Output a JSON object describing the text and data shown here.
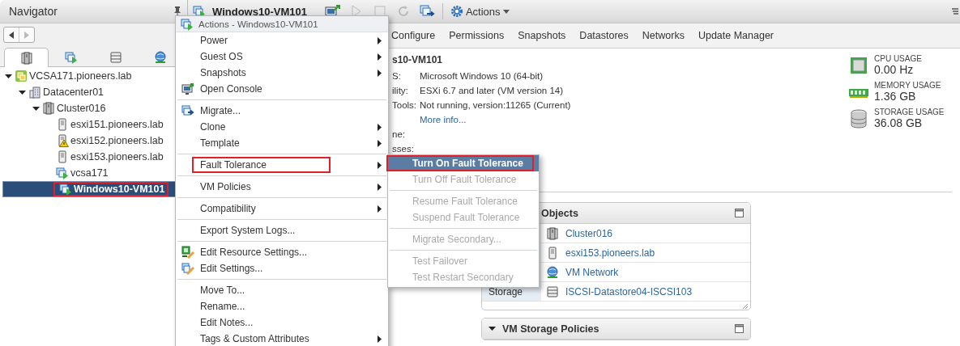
{
  "navigator": {
    "title": "Navigator",
    "tabs": [
      {
        "kind": "hosts",
        "selected": true
      },
      {
        "kind": "vms",
        "selected": false
      },
      {
        "kind": "storage",
        "selected": false
      },
      {
        "kind": "network",
        "selected": false
      }
    ],
    "tree": [
      {
        "label": "VCSA171.pioneers.lab",
        "kind": "vcenter",
        "expanded": true,
        "selected": false,
        "annotated": false,
        "children": [
          {
            "label": "Datacenter01",
            "kind": "datacenter",
            "expanded": true,
            "selected": false,
            "annotated": false,
            "children": [
              {
                "label": "Cluster016",
                "kind": "cluster",
                "expanded": true,
                "selected": false,
                "annotated": false,
                "children": [
                  {
                    "label": "esxi151.pioneers.lab",
                    "kind": "host",
                    "selected": false,
                    "annotated": false
                  },
                  {
                    "label": "esxi152.pioneers.lab",
                    "kind": "host-warning",
                    "selected": false,
                    "annotated": false
                  },
                  {
                    "label": "esxi153.pioneers.lab",
                    "kind": "host",
                    "selected": false,
                    "annotated": false
                  },
                  {
                    "label": "vcsa171",
                    "kind": "vm",
                    "selected": false,
                    "annotated": false
                  },
                  {
                    "label": "Windows10-VM101",
                    "kind": "vm",
                    "selected": true,
                    "annotated": true
                  }
                ]
              }
            ]
          }
        ]
      }
    ]
  },
  "header": {
    "title": "Windows10-VM101",
    "actions": "Actions"
  },
  "tabs": [
    {
      "label": "Configure",
      "selected": false
    },
    {
      "label": "Permissions",
      "selected": false
    },
    {
      "label": "Snapshots",
      "selected": false
    },
    {
      "label": "Datastores",
      "selected": false
    },
    {
      "label": "Networks",
      "selected": false
    },
    {
      "label": "Update Manager",
      "selected": false
    }
  ],
  "summary": {
    "title": "s10-VM101",
    "properties": [
      {
        "label": "S:",
        "value": "Microsoft Windows 10 (64-bit)"
      },
      {
        "label": "ility:",
        "value": "ESXi 6.7 and later (VM version 14)"
      },
      {
        "label": "Tools:",
        "value": "Not running, version:11265 (Current)"
      },
      {
        "link": "More info..."
      },
      {
        "label": "ne:"
      },
      {
        "label": "sses:"
      }
    ]
  },
  "usage": [
    {
      "kind": "cpu",
      "label": "CPU USAGE",
      "value": "0.00 Hz"
    },
    {
      "kind": "memory",
      "label": "MEMORY USAGE",
      "value": "1.36 GB"
    },
    {
      "kind": "storage",
      "label": "STORAGE USAGE",
      "value": "36.08 GB"
    }
  ],
  "related_objects": {
    "title": "Objects",
    "rows": [
      {
        "kind": "cluster",
        "value": "Cluster016"
      },
      {
        "kind": "host",
        "value": "esxi153.pioneers.lab"
      },
      {
        "kind": "network",
        "value": "VM Network"
      },
      {
        "kind": "datastore",
        "label": "Storage",
        "value": "ISCSI-Datastore04-ISCSI103"
      }
    ]
  },
  "storage_policies": {
    "title": "VM Storage Policies",
    "expanded": true
  },
  "actions_menu": {
    "title": "Actions - Windows10-VM101",
    "groups": [
      [
        {
          "label": "Power",
          "kind": "plain",
          "submenu": true,
          "annotated": false
        },
        {
          "label": "Guest OS",
          "kind": "plain",
          "submenu": true,
          "annotated": false
        },
        {
          "label": "Snapshots",
          "kind": "plain",
          "submenu": true,
          "annotated": false
        },
        {
          "label": "Open Console",
          "kind": "console",
          "submenu": false,
          "annotated": false
        }
      ],
      [
        {
          "label": "Migrate...",
          "kind": "migrate",
          "submenu": false,
          "annotated": false
        },
        {
          "label": "Clone",
          "kind": "plain",
          "submenu": true,
          "annotated": false
        },
        {
          "label": "Template",
          "kind": "plain",
          "submenu": true,
          "annotated": false
        }
      ],
      [
        {
          "label": "Fault Tolerance",
          "kind": "plain",
          "submenu": true,
          "annotated": true
        }
      ],
      [
        {
          "label": "VM Policies",
          "kind": "plain",
          "submenu": true,
          "annotated": false
        }
      ],
      [
        {
          "label": "Compatibility",
          "kind": "plain",
          "submenu": true,
          "annotated": false
        }
      ],
      [
        {
          "label": "Export System Logs...",
          "kind": "plain",
          "submenu": false,
          "annotated": false
        }
      ],
      [
        {
          "label": "Edit Resource Settings...",
          "kind": "resource",
          "submenu": false,
          "annotated": false
        },
        {
          "label": "Edit Settings...",
          "kind": "settings",
          "submenu": false,
          "annotated": false
        }
      ],
      [
        {
          "label": "Move To...",
          "kind": "plain",
          "submenu": false,
          "annotated": false
        },
        {
          "label": "Rename...",
          "kind": "plain",
          "submenu": false,
          "annotated": false
        },
        {
          "label": "Edit Notes...",
          "kind": "plain",
          "submenu": false,
          "annotated": false
        },
        {
          "label": "Tags & Custom Attributes",
          "kind": "plain",
          "submenu": true,
          "annotated": false
        }
      ]
    ]
  },
  "fault_tolerance_menu": {
    "groups": [
      [
        {
          "label": "Turn On Fault Tolerance",
          "disabled": false,
          "selected": true,
          "annotated": true
        },
        {
          "label": "Turn Off Fault Tolerance",
          "disabled": true,
          "selected": false,
          "annotated": false
        }
      ],
      [
        {
          "label": "Resume Fault Tolerance",
          "disabled": true,
          "selected": false,
          "annotated": false
        },
        {
          "label": "Suspend Fault Tolerance",
          "disabled": true,
          "selected": false,
          "annotated": false
        }
      ],
      [
        {
          "label": "Migrate Secondary...",
          "disabled": true,
          "selected": false,
          "annotated": false
        }
      ],
      [
        {
          "label": "Test Failover",
          "disabled": true,
          "selected": false,
          "annotated": false
        },
        {
          "label": "Test Restart Secondary",
          "disabled": true,
          "selected": false,
          "annotated": false
        }
      ]
    ]
  }
}
